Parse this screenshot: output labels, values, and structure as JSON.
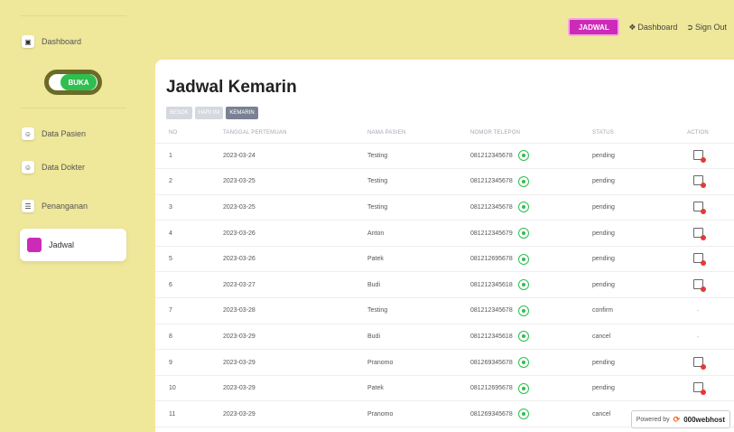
{
  "sidebar": {
    "items": [
      {
        "label": "Dashboard",
        "icon": "home-icon"
      },
      {
        "label": "Data Pasien",
        "icon": "user-plus-icon"
      },
      {
        "label": "Data Dokter",
        "icon": "user-plus-icon"
      },
      {
        "label": "Penanganan",
        "icon": "list-icon"
      },
      {
        "label": "Jadwal",
        "icon": "calendar-icon"
      }
    ],
    "toggle_label": "BUKA"
  },
  "topnav": {
    "jadwal_label": "JADWAL",
    "dashboard_label": "Dashboard",
    "signout_label": "Sign Out"
  },
  "main": {
    "title": "Jadwal Kemarin",
    "tabs": [
      {
        "label": "BESOK"
      },
      {
        "label": "HARI INI"
      },
      {
        "label": "KEMARIN"
      }
    ],
    "headers": [
      "NO",
      "TANGGAL PERTEMUAN",
      "NAMA PASIEN",
      "NOMOR TELEPON",
      "STATUS",
      "ACTION"
    ],
    "rows": [
      {
        "no": "1",
        "date": "2023-03-24",
        "name": "Testing",
        "phone": "081212345678",
        "status": "pending",
        "action": "calendar-remove"
      },
      {
        "no": "2",
        "date": "2023-03-25",
        "name": "Testing",
        "phone": "081212345678",
        "status": "pending",
        "action": "calendar-remove"
      },
      {
        "no": "3",
        "date": "2023-03-25",
        "name": "Testing",
        "phone": "081212345678",
        "status": "pending",
        "action": "calendar-remove"
      },
      {
        "no": "4",
        "date": "2023-03-26",
        "name": "Anton",
        "phone": "081212345679",
        "status": "pending",
        "action": "calendar-remove"
      },
      {
        "no": "5",
        "date": "2023-03-26",
        "name": "Patek",
        "phone": "081212695678",
        "status": "pending",
        "action": "calendar-remove"
      },
      {
        "no": "6",
        "date": "2023-03-27",
        "name": "Budi",
        "phone": "081212345618",
        "status": "pending",
        "action": "calendar-remove"
      },
      {
        "no": "7",
        "date": "2023-03-28",
        "name": "Testing",
        "phone": "081212345678",
        "status": "confirm",
        "action": "-"
      },
      {
        "no": "8",
        "date": "2023-03-29",
        "name": "Budi",
        "phone": "081212345618",
        "status": "cancel",
        "action": "-"
      },
      {
        "no": "9",
        "date": "2023-03-29",
        "name": "Pranomo",
        "phone": "081269345678",
        "status": "pending",
        "action": "calendar-remove"
      },
      {
        "no": "10",
        "date": "2023-03-29",
        "name": "Patek",
        "phone": "081212695678",
        "status": "pending",
        "action": "calendar-remove"
      },
      {
        "no": "11",
        "date": "2023-03-29",
        "name": "Pranomo",
        "phone": "081269345678",
        "status": "cancel",
        "action": "-"
      }
    ]
  },
  "footer": {
    "powered_by": "Powered by",
    "brand": "000webhost"
  },
  "colors": {
    "background": "#efe79a",
    "accent": "#cc2bb8",
    "toggle": "#2ebf4f",
    "whatsapp": "#2ebf4f",
    "delete": "#e53935"
  }
}
